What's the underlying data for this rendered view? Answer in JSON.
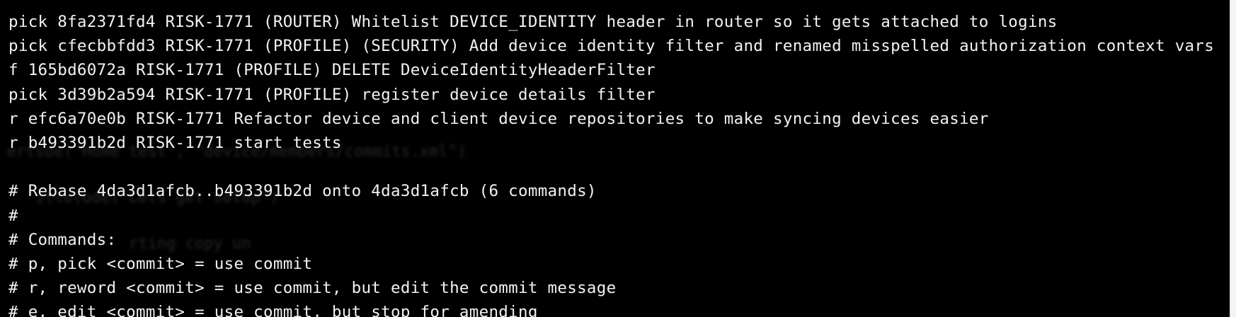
{
  "editor": {
    "lines": [
      "pick 8fa2371fd4 RISK-1771 (ROUTER) Whitelist DEVICE_IDENTITY header in router so it gets attached to logins",
      "pick cfecbbfdd3 RISK-1771 (PROFILE) (SECURITY) Add device identity filter and renamed misspelled authorization context vars",
      "f 165bd6072a RISK-1771 (PROFILE) DELETE DeviceIdentityHeaderFilter",
      "pick 3d39b2a594 RISK-1771 (PROFILE) register device details filter",
      "r efc6a70e0b RISK-1771 Refactor device and client device repositories to make syncing devices easier",
      "r b493391b2d RISK-1771 start tests",
      "",
      "# Rebase 4da3d1afcb..b493391b2d onto 4da3d1afcb (6 commands)",
      "#",
      "# Commands:",
      "# p, pick <commit> = use commit",
      "# r, reword <commit> = use commit, but edit the commit message",
      "# e, edit <commit> = use commit, but stop for amending"
    ]
  },
  "ghost_text": [
    "ertsde(\"Home test\", \"device/members/commits.xml\")",
    "   itle(ode(\"Lets get setup\")",
    "             rting copy un"
  ],
  "colors": {
    "background": "#000000",
    "foreground": "#f2f2f2"
  }
}
